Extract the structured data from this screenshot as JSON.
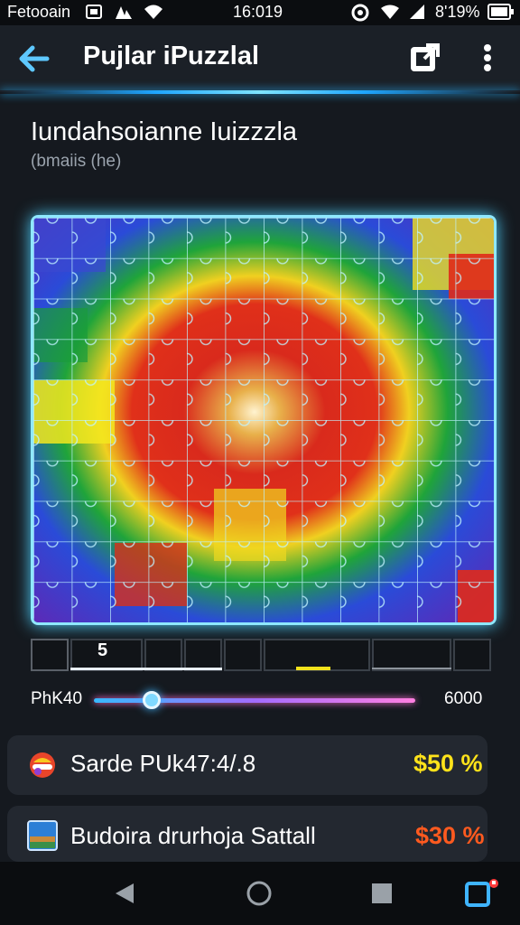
{
  "status_bar": {
    "carrier": "Fetooain",
    "time": "16:019",
    "battery": "8'19%"
  },
  "app_bar": {
    "title": "Pujlar iPuzzlal",
    "icons": [
      "back-arrow-icon",
      "share-icon",
      "more-vert-icon"
    ]
  },
  "puzzle": {
    "title": "Iundahsoianne Iuizzzla",
    "subtitle": "(bmaiis (he)"
  },
  "piece_strip": {
    "count_label": "5"
  },
  "slider": {
    "left_label": "PhK40",
    "right_label": "6000",
    "value_fraction": 0.18
  },
  "cards": [
    {
      "label": "Sarde PUk47:4/.8",
      "price": "$50 %",
      "price_color": "#ffe31a",
      "icon": "puzzle-brain-icon"
    },
    {
      "label": "Budoira drurhoja Sattall",
      "price": "$30 %",
      "price_color": "#ff5a1f",
      "icon": "landscape-thumbnail-icon"
    }
  ],
  "nav_bar": {
    "icons": [
      "nav-back-icon",
      "nav-home-icon",
      "nav-recents-icon",
      "nav-app-icon"
    ]
  }
}
